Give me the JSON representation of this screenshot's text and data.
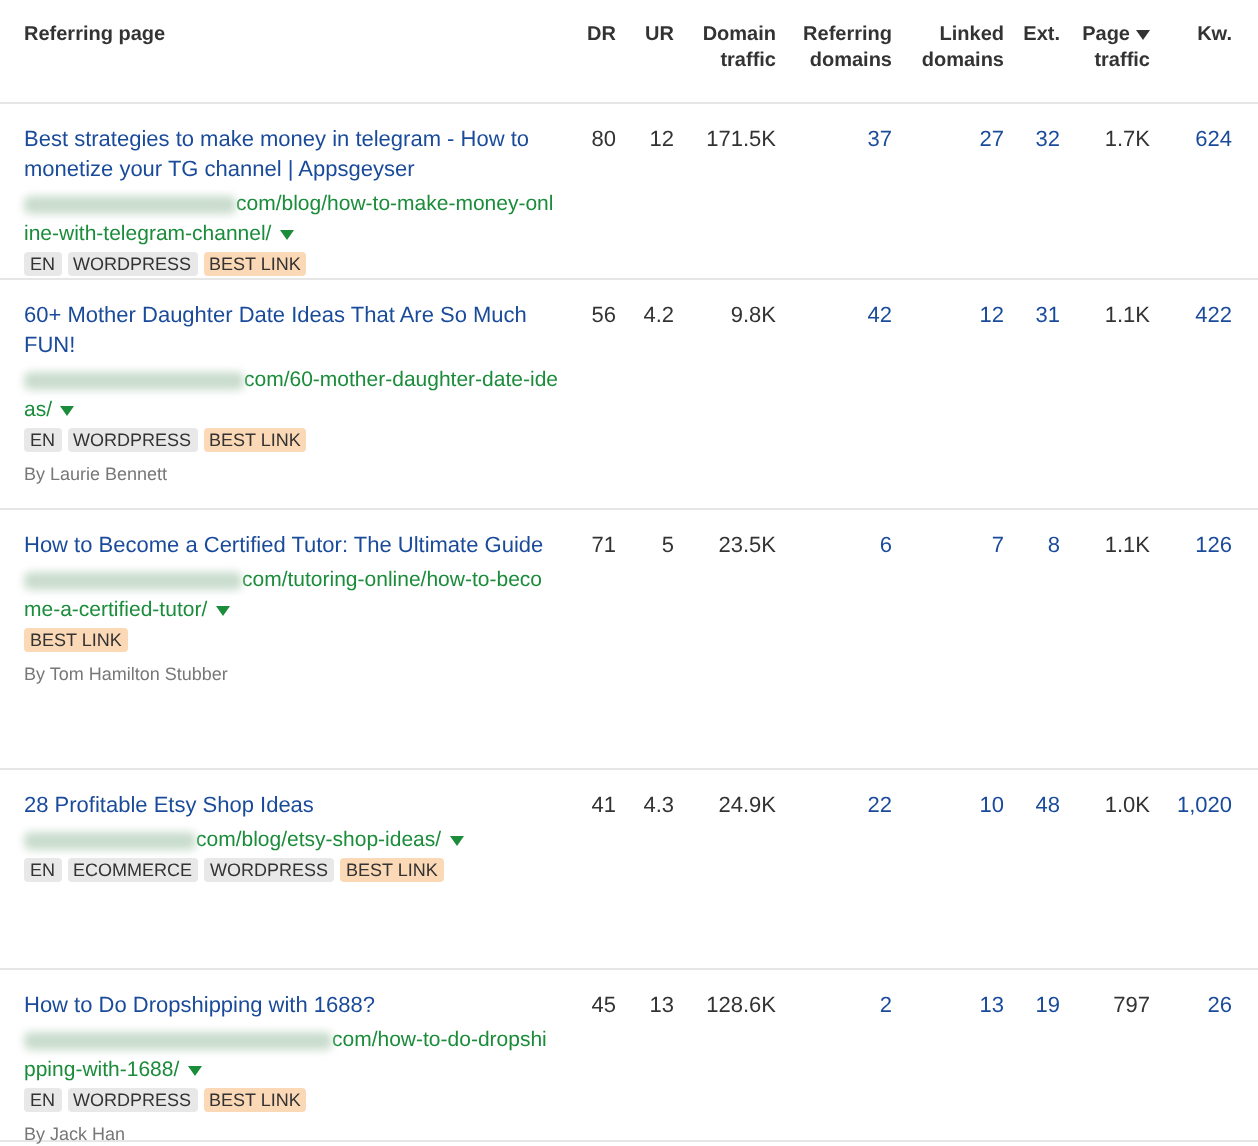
{
  "columns": [
    {
      "label": "Referring page",
      "sorted": false
    },
    {
      "label": "DR",
      "sorted": false
    },
    {
      "label": "UR",
      "sorted": false
    },
    {
      "label": "Domain traffic",
      "sorted": false
    },
    {
      "label": "Referring domains",
      "sorted": false
    },
    {
      "label": "Linked domains",
      "sorted": false
    },
    {
      "label": "Ext.",
      "sorted": false
    },
    {
      "label": "Page traffic",
      "sorted": true
    },
    {
      "label": "Kw.",
      "sorted": false
    }
  ],
  "rows": [
    {
      "title": "Best strategies to make money in telegram - How to monetize your TG channel | Appsgeyser",
      "url": "com/blog/how-to-make-money-online-with-telegram-channel/",
      "tags": [
        {
          "label": "EN",
          "kind": "plain"
        },
        {
          "label": "WORDPRESS",
          "kind": "plain"
        },
        {
          "label": "BEST LINK",
          "kind": "best"
        }
      ],
      "dr": "80",
      "ur": "12",
      "domain_traffic": "171.5K",
      "referring_domains": "37",
      "linked_domains": "27",
      "ext": "32",
      "page_traffic": "1.7K",
      "kw": "624"
    },
    {
      "title": "60+ Mother Daughter Date Ideas That Are So Much FUN!",
      "url": "com/60-mother-daughter-date-ideas/",
      "tags": [
        {
          "label": "EN",
          "kind": "plain"
        },
        {
          "label": "WORDPRESS",
          "kind": "plain"
        },
        {
          "label": "BEST LINK",
          "kind": "best"
        }
      ],
      "author": "By Laurie Bennett",
      "dr": "56",
      "ur": "4.2",
      "domain_traffic": "9.8K",
      "referring_domains": "42",
      "linked_domains": "12",
      "ext": "31",
      "page_traffic": "1.1K",
      "kw": "422"
    },
    {
      "title": "How to Become a Certified Tutor: The Ultimate Guide",
      "url": "com/tutoring-online/how-to-become-a-certified-tutor/",
      "tags": [
        {
          "label": "BEST LINK",
          "kind": "best"
        }
      ],
      "author": "By Tom Hamilton Stubber",
      "dr": "71",
      "ur": "5",
      "domain_traffic": "23.5K",
      "referring_domains": "6",
      "linked_domains": "7",
      "ext": "8",
      "page_traffic": "1.1K",
      "kw": "126"
    },
    {
      "title": "28 Profitable Etsy Shop Ideas",
      "url": "com/blog/etsy-shop-ideas/",
      "tags": [
        {
          "label": "EN",
          "kind": "plain"
        },
        {
          "label": "ECOMMERCE",
          "kind": "plain"
        },
        {
          "label": "WORDPRESS",
          "kind": "plain"
        },
        {
          "label": "BEST LINK",
          "kind": "best"
        }
      ],
      "dr": "41",
      "ur": "4.3",
      "domain_traffic": "24.9K",
      "referring_domains": "22",
      "linked_domains": "10",
      "ext": "48",
      "page_traffic": "1.0K",
      "kw": "1,020"
    },
    {
      "title": "How to Do Dropshipping with 1688?",
      "url": "com/how-to-do-dropshipping-with-1688/",
      "tags": [
        {
          "label": "EN",
          "kind": "plain"
        },
        {
          "label": "WORDPRESS",
          "kind": "plain"
        },
        {
          "label": "BEST LINK",
          "kind": "best"
        }
      ],
      "author": "By Jack Han",
      "dr": "45",
      "ur": "13",
      "domain_traffic": "128.6K",
      "referring_domains": "2",
      "linked_domains": "13",
      "ext": "19",
      "page_traffic": "797",
      "kw": "26"
    }
  ]
}
